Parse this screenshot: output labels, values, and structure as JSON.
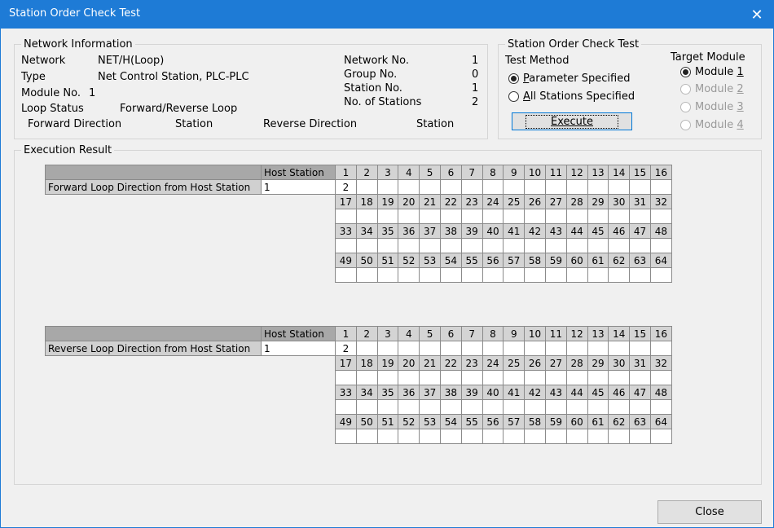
{
  "window": {
    "title": "Station Order Check Test",
    "close_glyph": "✕"
  },
  "network_info": {
    "legend": "Network Information",
    "network_label": "Network",
    "network_value": "NET/H(Loop)",
    "type_label": "Type",
    "type_value": "Net Control Station, PLC-PLC",
    "module_label": "Module No.",
    "module_value": "1",
    "loop_status_label": "Loop Status",
    "loop_status_value": "Forward/Reverse Loop",
    "network_no_label": "Network No.",
    "network_no_value": "1",
    "group_no_label": "Group No.",
    "group_no_value": "0",
    "station_no_label": "Station No.",
    "station_no_value": "1",
    "num_stations_label": "No. of Stations",
    "num_stations_value": "2",
    "forward_direction_label": "Forward Direction",
    "forward_station_label": "Station",
    "reverse_direction_label": "Reverse Direction",
    "reverse_station_label": "Station"
  },
  "test": {
    "legend": "Station Order Check Test",
    "method_label": "Test Method",
    "method_options": [
      {
        "prefix": "",
        "accel": "P",
        "rest": "arameter Specified",
        "selected": true
      },
      {
        "prefix": "",
        "accel": "A",
        "rest": "ll Stations Specified",
        "selected": false
      }
    ],
    "execute_label": "Execute",
    "target_label": "Target Module",
    "target_options": [
      {
        "prefix": "Module ",
        "accel": "1",
        "selected": true,
        "enabled": true
      },
      {
        "prefix": "Module ",
        "accel": "2",
        "selected": false,
        "enabled": false
      },
      {
        "prefix": "Module ",
        "accel": "3",
        "selected": false,
        "enabled": false
      },
      {
        "prefix": "Module ",
        "accel": "4",
        "selected": false,
        "enabled": false
      }
    ]
  },
  "result": {
    "legend": "Execution Result",
    "host_station_header": "Host Station",
    "rows": [
      [
        "1",
        "2",
        "3",
        "4",
        "5",
        "6",
        "7",
        "8",
        "9",
        "10",
        "11",
        "12",
        "13",
        "14",
        "15",
        "16"
      ],
      [
        "17",
        "18",
        "19",
        "20",
        "21",
        "22",
        "23",
        "24",
        "25",
        "26",
        "27",
        "28",
        "29",
        "30",
        "31",
        "32"
      ],
      [
        "33",
        "34",
        "35",
        "36",
        "37",
        "38",
        "39",
        "40",
        "41",
        "42",
        "43",
        "44",
        "45",
        "46",
        "47",
        "48"
      ],
      [
        "49",
        "50",
        "51",
        "52",
        "53",
        "54",
        "55",
        "56",
        "57",
        "58",
        "59",
        "60",
        "61",
        "62",
        "63",
        "64"
      ]
    ],
    "forward": {
      "label": "Forward Loop Direction from Host Station",
      "host": "1",
      "first_value": "2"
    },
    "reverse": {
      "label": "Reverse Loop Direction from Host Station",
      "host": "1",
      "first_value": "2"
    }
  },
  "footer": {
    "close_label": "Close"
  }
}
